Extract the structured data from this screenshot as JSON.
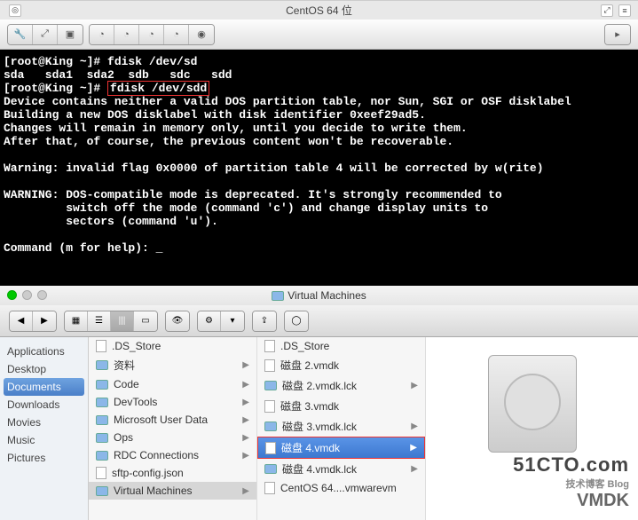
{
  "window": {
    "title": "CentOS 64 位"
  },
  "terminal": {
    "l1": "[root@King ~]# fdisk /dev/sd",
    "l2": "sda   sda1  sda2  sdb   sdc   sdd",
    "l3a": "[root@King ~]# ",
    "l3b": "fdisk /dev/sdd",
    "l4": "Device contains neither a valid DOS partition table, nor Sun, SGI or OSF disklabel",
    "l5": "Building a new DOS disklabel with disk identifier 0xeef29ad5.",
    "l6": "Changes will remain in memory only, until you decide to write them.",
    "l7": "After that, of course, the previous content won't be recoverable.",
    "l8": "",
    "l9": "Warning: invalid flag 0x0000 of partition table 4 will be corrected by w(rite)",
    "l10": "",
    "l11": "WARNING: DOS-compatible mode is deprecated. It's strongly recommended to",
    "l12": "         switch off the mode (command 'c') and change display units to",
    "l13": "         sectors (command 'u').",
    "l14": "",
    "l15": "Command (m for help): _"
  },
  "finder": {
    "title": "Virtual Machines",
    "sidebar": {
      "items": [
        "Applications",
        "Desktop",
        "Documents",
        "Downloads",
        "Movies",
        "Music",
        "Pictures"
      ],
      "selected_idx": 2
    },
    "col1": [
      {
        "name": ".DS_Store",
        "type": "file"
      },
      {
        "name": "资料",
        "type": "folder"
      },
      {
        "name": "Code",
        "type": "folder"
      },
      {
        "name": "DevTools",
        "type": "folder"
      },
      {
        "name": "Microsoft User Data",
        "type": "folder"
      },
      {
        "name": "Ops",
        "type": "folder"
      },
      {
        "name": "RDC Connections",
        "type": "folder"
      },
      {
        "name": "sftp-config.json",
        "type": "file"
      },
      {
        "name": "Virtual Machines",
        "type": "folder",
        "selected": true
      }
    ],
    "col2": [
      {
        "name": ".DS_Store",
        "type": "file"
      },
      {
        "name": "磁盘 2.vmdk",
        "type": "file"
      },
      {
        "name": "磁盘 2.vmdk.lck",
        "type": "folder"
      },
      {
        "name": "磁盘 3.vmdk",
        "type": "file"
      },
      {
        "name": "磁盘 3.vmdk.lck",
        "type": "folder"
      },
      {
        "name": "磁盘 4.vmdk",
        "type": "file",
        "selected": true
      },
      {
        "name": "磁盘 4.vmdk.lck",
        "type": "folder"
      },
      {
        "name": "CentOS 64....vmwarevm",
        "type": "file"
      }
    ]
  },
  "watermark": {
    "main": "51CTO.com",
    "sub": "技术博客   Blog",
    "type": "VMDK"
  }
}
